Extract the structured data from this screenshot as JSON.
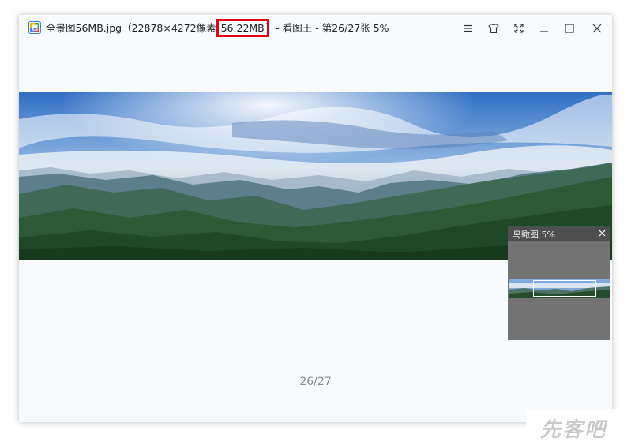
{
  "window": {
    "title_prefix": "全景图56MB.jpg（22878×4272像素 ",
    "title_filesize": "56.22MB",
    "title_suffix": "）- 看图王 - 第26/27张 5%"
  },
  "window_controls": {
    "icons": [
      "menu-icon",
      "skin-icon",
      "fullscreen-icon",
      "minimize-icon",
      "maximize-icon",
      "close-icon"
    ]
  },
  "viewer": {
    "page_counter": "26/27"
  },
  "birdseye": {
    "title": "鸟瞰图 5%"
  },
  "watermark": {
    "text": "先客吧"
  },
  "colors": {
    "highlight": "#e60012",
    "window_bg": "#f7fbfd",
    "birdseye_bg": "#737373"
  }
}
